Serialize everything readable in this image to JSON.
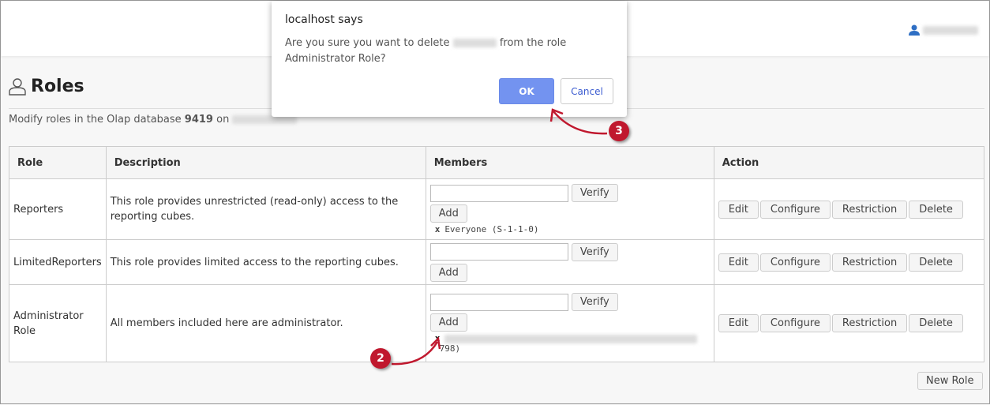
{
  "header": {
    "user_icon": "user-icon",
    "accent": "#2f6fc4"
  },
  "page": {
    "title": "Roles",
    "subtitle_prefix": "Modify roles in the Olap database",
    "database": "9419",
    "subtitle_on": "on"
  },
  "table": {
    "headers": [
      "Role",
      "Description",
      "Members",
      "Action"
    ],
    "rows": [
      {
        "role": "Reporters",
        "description": "This role provides unrestricted (read-only) access to the reporting cubes.",
        "members": [
          "Everyone (S-1-1-0)"
        ]
      },
      {
        "role": "LimitedReporters",
        "description": "This role provides limited access to the reporting cubes.",
        "members": []
      },
      {
        "role": "Administrator Role",
        "description": "All members included here are administrator.",
        "member_suffix": "798)"
      }
    ],
    "verify": "Verify",
    "add": "Add",
    "remove": "x",
    "actions": [
      "Edit",
      "Configure",
      "Restriction",
      "Delete"
    ]
  },
  "new_role": "New Role",
  "dialog": {
    "title": "localhost says",
    "msg_prefix": "Are you sure you want to delete",
    "msg_suffix": "from the role Administrator Role?",
    "ok": "OK",
    "cancel": "Cancel",
    "ok_color": "#7393f0"
  },
  "callouts": [
    "2",
    "3"
  ]
}
